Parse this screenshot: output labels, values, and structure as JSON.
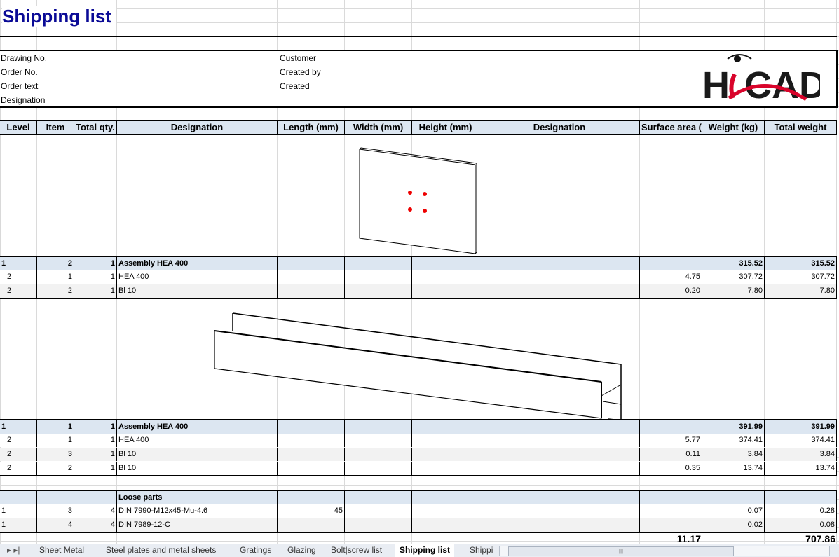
{
  "title": "Shipping list",
  "info": {
    "drawing_no": "Drawing No.",
    "order_no": "Order No.",
    "order_text": "Order text",
    "designation": "Designation",
    "customer": "Customer",
    "created_by": "Created by",
    "created": "Created",
    "logo_text": "HiCAD"
  },
  "columns": [
    "Level",
    "Item",
    "Total qty.",
    "Designation",
    "Length (mm)",
    "Width (mm)",
    "Height (mm)",
    "Designation",
    "Surface area (m",
    "Weight (kg)",
    "Total weight"
  ],
  "rows": [
    {
      "style": "assembly",
      "cells": [
        "1",
        "2",
        "1",
        "Assembly HEA 400",
        "",
        "",
        "",
        "",
        "",
        "315.52",
        "315.52"
      ]
    },
    {
      "style": "white",
      "cells": [
        "2",
        "1",
        "1",
        "HEA 400",
        "",
        "",
        "",
        "",
        "4.75",
        "307.72",
        "307.72"
      ]
    },
    {
      "style": "grey",
      "cells": [
        "2",
        "2",
        "1",
        "Bl 10",
        "",
        "",
        "",
        "",
        "0.20",
        "7.80",
        "7.80"
      ]
    },
    {
      "style": "assembly",
      "cells": [
        "1",
        "1",
        "1",
        "Assembly HEA 400",
        "",
        "",
        "",
        "",
        "",
        "391.99",
        "391.99"
      ]
    },
    {
      "style": "white",
      "cells": [
        "2",
        "1",
        "1",
        "HEA 400",
        "",
        "",
        "",
        "",
        "5.77",
        "374.41",
        "374.41"
      ]
    },
    {
      "style": "grey",
      "cells": [
        "2",
        "3",
        "1",
        "Bl 10",
        "",
        "",
        "",
        "",
        "0.11",
        "3.84",
        "3.84"
      ]
    },
    {
      "style": "white",
      "cells": [
        "2",
        "2",
        "1",
        "Bl 10",
        "",
        "",
        "",
        "",
        "0.35",
        "13.74",
        "13.74"
      ]
    },
    {
      "style": "assembly",
      "cells": [
        "",
        "",
        "",
        "Loose parts",
        "",
        "",
        "",
        "",
        "",
        "",
        ""
      ]
    },
    {
      "style": "white",
      "cells": [
        "1",
        "3",
        "4",
        "DIN 7990-M12x45-Mu-4.6",
        "45",
        "",
        "",
        "",
        "",
        "0.07",
        "0.28"
      ]
    },
    {
      "style": "grey",
      "cells": [
        "1",
        "4",
        "4",
        "DIN 7989-12-C",
        "",
        "",
        "",
        "",
        "",
        "0.02",
        "0.08"
      ]
    }
  ],
  "totals": {
    "surface_area": "11.17",
    "total_weight": "707.86"
  },
  "sheet_tabs": [
    "Sheet Metal",
    "Steel plates and metal sheets",
    "Gratings",
    "Glazing",
    "Bolt|screw list",
    "Shipping list",
    "Shippi"
  ],
  "active_tab": "Shipping list",
  "colors": {
    "title": "#0a0a96",
    "header_bg": "#dce6f1",
    "logo_red": "#d9042b"
  }
}
